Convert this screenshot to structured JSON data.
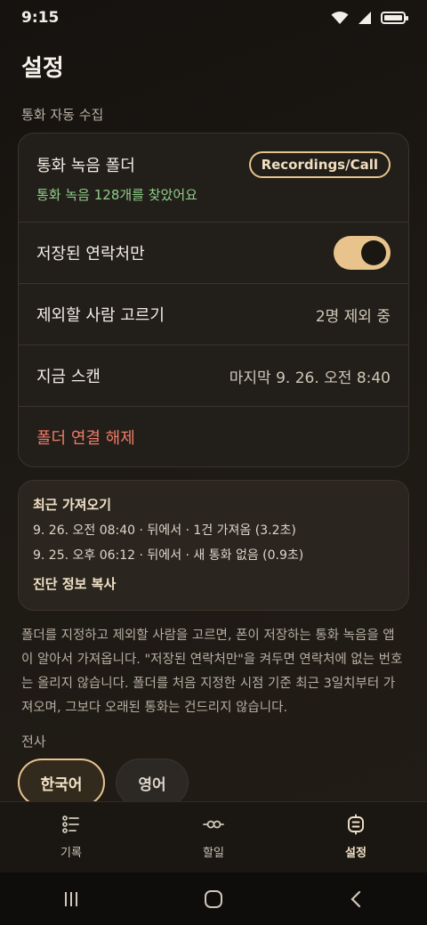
{
  "status": {
    "time": "9:15"
  },
  "page": {
    "title": "설정"
  },
  "section_auto": "통화 자동 수집",
  "folder_row": {
    "label": "통화 녹음 폴더",
    "folder_badge": "Recordings/Call",
    "found_text": "통화 녹음 128개를 찾았어요"
  },
  "contacts_only_row": {
    "label": "저장된 연락처만",
    "enabled": true
  },
  "exclude_row": {
    "label": "제외할 사람 고르기",
    "value": "2명 제외 중"
  },
  "scan_row": {
    "label": "지금 스캔",
    "value": "마지막 9. 26. 오전 8:40"
  },
  "disconnect_row": {
    "label": "폴더 연결 해제"
  },
  "recent": {
    "title": "최근 가져오기",
    "lines": [
      "9. 26. 오전 08:40 · 뒤에서 · 1건 가져옴 (3.2초)",
      "9. 25. 오후 06:12 · 뒤에서 · 새 통화 없음 (0.9초)"
    ],
    "copy_label": "진단 정보 복사"
  },
  "description": "폴더를 지정하고 제외할 사람을 고르면, 폰이 저장하는 통화 녹음을 앱이 알아서 가져옵니다. \"저장된 연락처만\"을 켜두면 연락처에 없는 번호는 올리지 않습니다. 폴더를 처음 지정한 시점 기준 최근 3일치부터 가져오며, 그보다 오래된 통화는 건드리지 않습니다.",
  "section_transcribe": "전사",
  "language_chips": [
    {
      "label": "한국어",
      "selected": true
    },
    {
      "label": "영어",
      "selected": false
    }
  ],
  "bottom_nav": [
    {
      "label": "기록",
      "icon": "list-icon",
      "active": false
    },
    {
      "label": "할일",
      "icon": "link-icon",
      "active": false
    },
    {
      "label": "설정",
      "icon": "settings-icon",
      "active": true
    }
  ],
  "colors": {
    "accent": "#e6c48e",
    "success": "#8fcf8a",
    "danger": "#ee7c68",
    "background": "#1d1914"
  },
  "system_nav_icons": [
    "recents-icon",
    "home-icon",
    "back-icon"
  ]
}
